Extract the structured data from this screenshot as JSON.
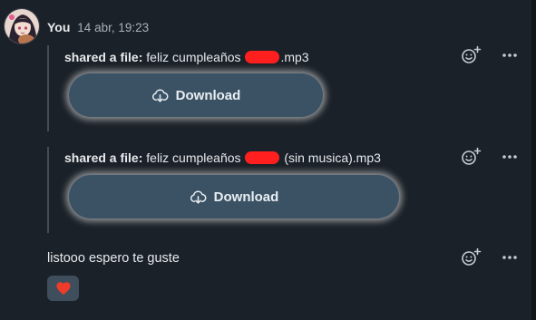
{
  "author": {
    "name": "You",
    "timestamp": "14 abr, 19:23"
  },
  "files": [
    {
      "prefix": "shared a file:",
      "name_before": "feliz cumpleaños",
      "name_after": ".mp3",
      "download_label": "Download"
    },
    {
      "prefix": "shared a file:",
      "name_before": "feliz cumpleaños",
      "name_after": "(sin musica).mp3",
      "download_label": "Download"
    }
  ],
  "message": {
    "text": "listooo espero te guste"
  },
  "reaction": {
    "emoji": "heart",
    "color": "#ef3b2c"
  },
  "icons": {
    "add_reaction": "add-reaction-icon",
    "more": "more-options-icon",
    "download": "cloud-download-icon"
  },
  "colors": {
    "background": "#1b2128",
    "button": "#3b5265",
    "redaction": "#ff1f1f"
  }
}
